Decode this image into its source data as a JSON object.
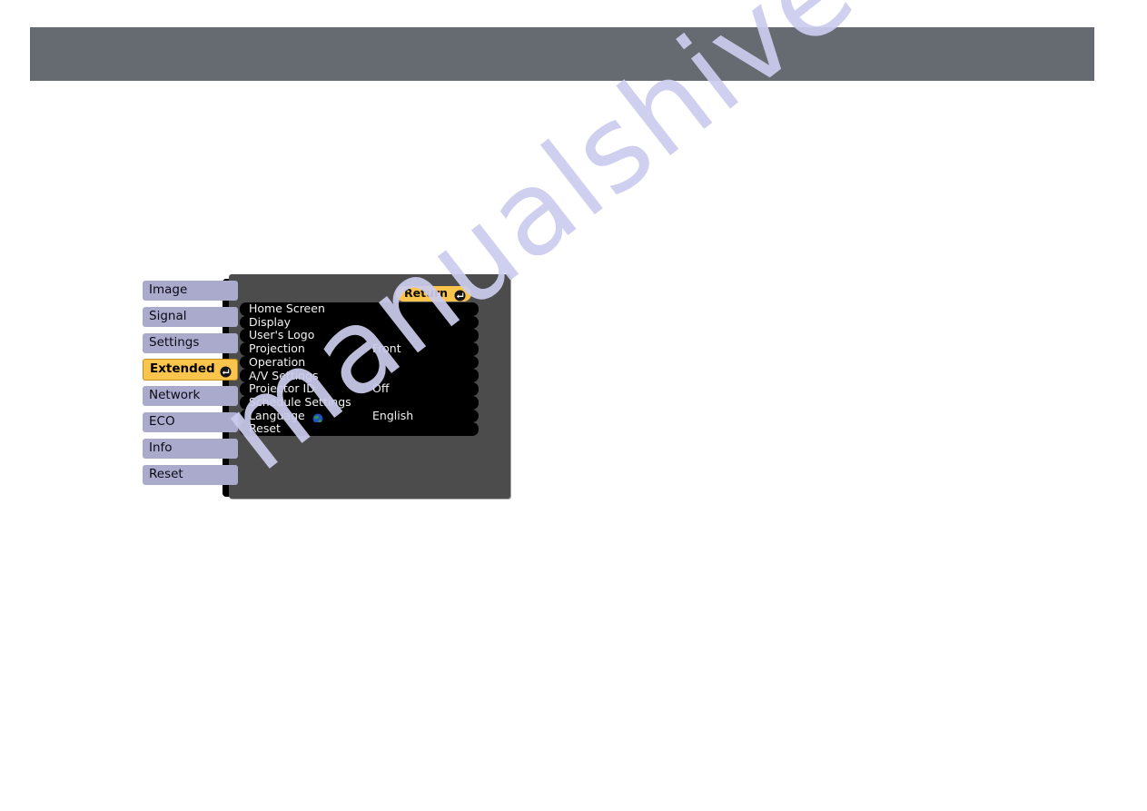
{
  "page": {
    "background_color": "#ffffff",
    "header_band_color": "#666a71"
  },
  "watermark": {
    "text": "manualshive.com",
    "color": "#ccccee"
  },
  "osd": {
    "panel_color": "#4c4c4c",
    "accent_color": "#fbc44d",
    "tab_color": "#aaaacd",
    "list_background": "#000000",
    "return_button": {
      "label": "Return",
      "icon": "enter-icon"
    },
    "tabs": [
      {
        "label": "Image",
        "selected": false
      },
      {
        "label": "Signal",
        "selected": false
      },
      {
        "label": "Settings",
        "selected": false
      },
      {
        "label": "Extended",
        "selected": true,
        "icon": "enter-icon"
      },
      {
        "label": "Network",
        "selected": false
      },
      {
        "label": "ECO",
        "selected": false
      },
      {
        "label": "Info",
        "selected": false
      },
      {
        "label": "Reset",
        "selected": false
      }
    ],
    "items": [
      {
        "label": "Home Screen",
        "value": ""
      },
      {
        "label": "Display",
        "value": ""
      },
      {
        "label": "User's Logo",
        "value": ""
      },
      {
        "label": "Projection",
        "value": "Front"
      },
      {
        "label": "Operation",
        "value": ""
      },
      {
        "label": "A/V Settings",
        "value": ""
      },
      {
        "label": "Projector ID",
        "value": "Off"
      },
      {
        "label": "Schedule Settings",
        "value": ""
      },
      {
        "label": "Language",
        "value": "English",
        "icon": "globe-icon"
      },
      {
        "label": "Reset",
        "value": ""
      }
    ]
  }
}
